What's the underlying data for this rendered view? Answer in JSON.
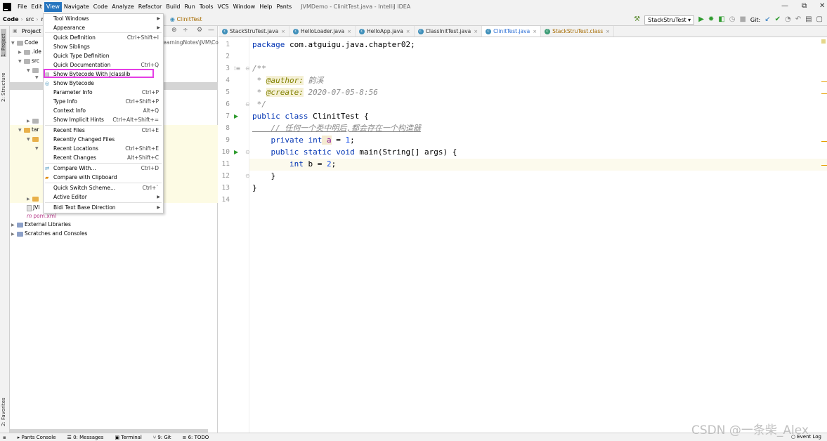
{
  "window": {
    "title": "JVMDemo - ClinitTest.java - IntelliJ IDEA",
    "controls": [
      "—",
      "⧉",
      "✕"
    ]
  },
  "menubar": {
    "items": [
      "File",
      "Edit",
      "View",
      "Navigate",
      "Code",
      "Analyze",
      "Refactor",
      "Build",
      "Run",
      "Tools",
      "VCS",
      "Window",
      "Help",
      "Pants"
    ],
    "active": "View"
  },
  "navbar": {
    "crumbs": [
      "Code",
      "src",
      "r"
    ],
    "tail": "ClinitTest",
    "run_config": "StackStruTest",
    "git_label": "Git:"
  },
  "view_menu": {
    "items": [
      {
        "label": "Tool Windows",
        "shortcut": "",
        "submenu": true
      },
      {
        "label": "Appearance",
        "shortcut": "",
        "submenu": true
      },
      {
        "label": "Quick Definition",
        "shortcut": "Ctrl+Shift+I"
      },
      {
        "label": "Show Siblings",
        "shortcut": ""
      },
      {
        "label": "Quick Type Definition",
        "shortcut": ""
      },
      {
        "label": "Quick Documentation",
        "shortcut": "Ctrl+Q"
      },
      {
        "label": "Show Bytecode With Jclasslib",
        "shortcut": "",
        "highlighted": true
      },
      {
        "label": "Show Bytecode",
        "shortcut": ""
      },
      {
        "label": "Parameter Info",
        "shortcut": "Ctrl+P"
      },
      {
        "label": "Type Info",
        "shortcut": "Ctrl+Shift+P"
      },
      {
        "label": "Context Info",
        "shortcut": "Alt+Q"
      },
      {
        "label": "Show Implicit Hints",
        "shortcut": "Ctrl+Alt+Shift+="
      },
      {
        "label": "Recent Files",
        "shortcut": "Ctrl+E"
      },
      {
        "label": "Recently Changed Files",
        "shortcut": ""
      },
      {
        "label": "Recent Locations",
        "shortcut": "Ctrl+Shift+E"
      },
      {
        "label": "Recent Changes",
        "shortcut": "Alt+Shift+C"
      },
      {
        "label": "Compare With...",
        "shortcut": "Ctrl+D"
      },
      {
        "label": "Compare with Clipboard",
        "shortcut": ""
      },
      {
        "label": "Quick Switch Scheme...",
        "shortcut": "Ctrl+`"
      },
      {
        "label": "Active Editor",
        "shortcut": "",
        "submenu": true
      },
      {
        "label": "Bidi Text Base Direction",
        "shortcut": "",
        "submenu": true
      }
    ]
  },
  "project_panel": {
    "title": "Project",
    "path_fragment": "earningNotes\\JVM\\Co",
    "tree": [
      {
        "label": "Code"
      },
      {
        "label": ".ide"
      },
      {
        "label": "src"
      },
      {
        "label": "tar"
      },
      {
        "label": "JVI"
      },
      {
        "label": "pom.xml"
      },
      {
        "label": "External Libraries"
      },
      {
        "label": "Scratches and Consoles"
      }
    ]
  },
  "tabs": [
    {
      "label": "StackStruTest.java"
    },
    {
      "label": "HelloLoader.java"
    },
    {
      "label": "HelloApp.java"
    },
    {
      "label": "ClassInitTest.java"
    },
    {
      "label": "ClinitTest.java",
      "active": true
    },
    {
      "label": "StackStruTest.class"
    }
  ],
  "editor": {
    "line_numbers": [
      "1",
      "2",
      "3",
      "4",
      "5",
      "6",
      "7",
      "8",
      "9",
      "10",
      "11",
      "12",
      "13",
      "14"
    ],
    "code": {
      "l1_kw": "package",
      "l1_rest": " com.atguigu.java.chapter02;",
      "l3": "/**",
      "l4_prefix": " * ",
      "l4_tag": "@author:",
      "l4_val": " 韵溪",
      "l5_prefix": " * ",
      "l5_tag": "@create:",
      "l5_val": " 2020-07-05-8:56",
      "l6": " */",
      "l7_kw": "public class",
      "l7_rest": " ClinitTest {",
      "l8": "    // 任何一个类中明后,都会存在一个构造器",
      "l9_kw": "    private int",
      "l9_var": " a",
      "l9_eq": " = ",
      "l9_num": "1",
      "l9_end": ";",
      "l10_kw": "    public static void",
      "l10_rest": " main(String[] args) {",
      "l11_kw": "        int",
      "l11_rest": " b = ",
      "l11_num": "2",
      "l11_end": ";",
      "l12": "    }",
      "l13": "}"
    }
  },
  "side_tabs": {
    "project": "1: Project",
    "structure": "2: Structure",
    "favorites": "2: Favorites"
  },
  "statusbar": {
    "tabs": [
      "Pants Console",
      "0: Messages",
      "Terminal",
      "9: Git",
      "6: TODO"
    ],
    "event_log": "Event Log"
  },
  "watermark": "CSDN @一条柴_Alex"
}
